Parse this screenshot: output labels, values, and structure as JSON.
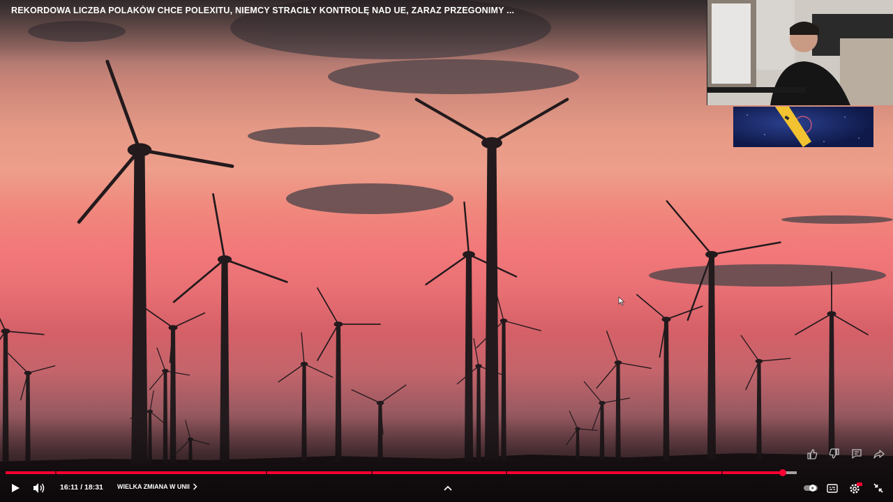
{
  "video": {
    "title": "REKORDOWA LICZBA POLAKÓW CHCE POLEXITU, NIEMCY STRACIŁY KONTROLĘ NAD UE, ZARAZ PRZEGONIMY ..."
  },
  "player": {
    "time_display": "16:11 / 18:31",
    "chapter_label": "WIELKA ZMIANA W UNII",
    "played_fraction": 0.982,
    "buffered_fraction": 1.0,
    "chapter_markers": [
      0.063,
      0.329,
      0.462,
      0.632,
      0.905
    ]
  },
  "colors": {
    "progress_played": "#ff0033",
    "sky_top": "#6b5b5e",
    "sky_mid": "#f0877c",
    "silhouette": "#231a1d"
  },
  "icons": {
    "play": "play-icon",
    "volume": "volume-icon",
    "chapter": "chevron-right-icon",
    "expand": "chevron-up-icon",
    "autoplay": "autoplay-toggle-icon",
    "subtitles": "subtitles-icon",
    "settings": "settings-icon",
    "fullscreen": "exit-fullscreen-icon",
    "like": "thumbs-up-icon",
    "dislike": "thumbs-down-icon",
    "comments": "comments-icon",
    "share": "share-icon"
  }
}
